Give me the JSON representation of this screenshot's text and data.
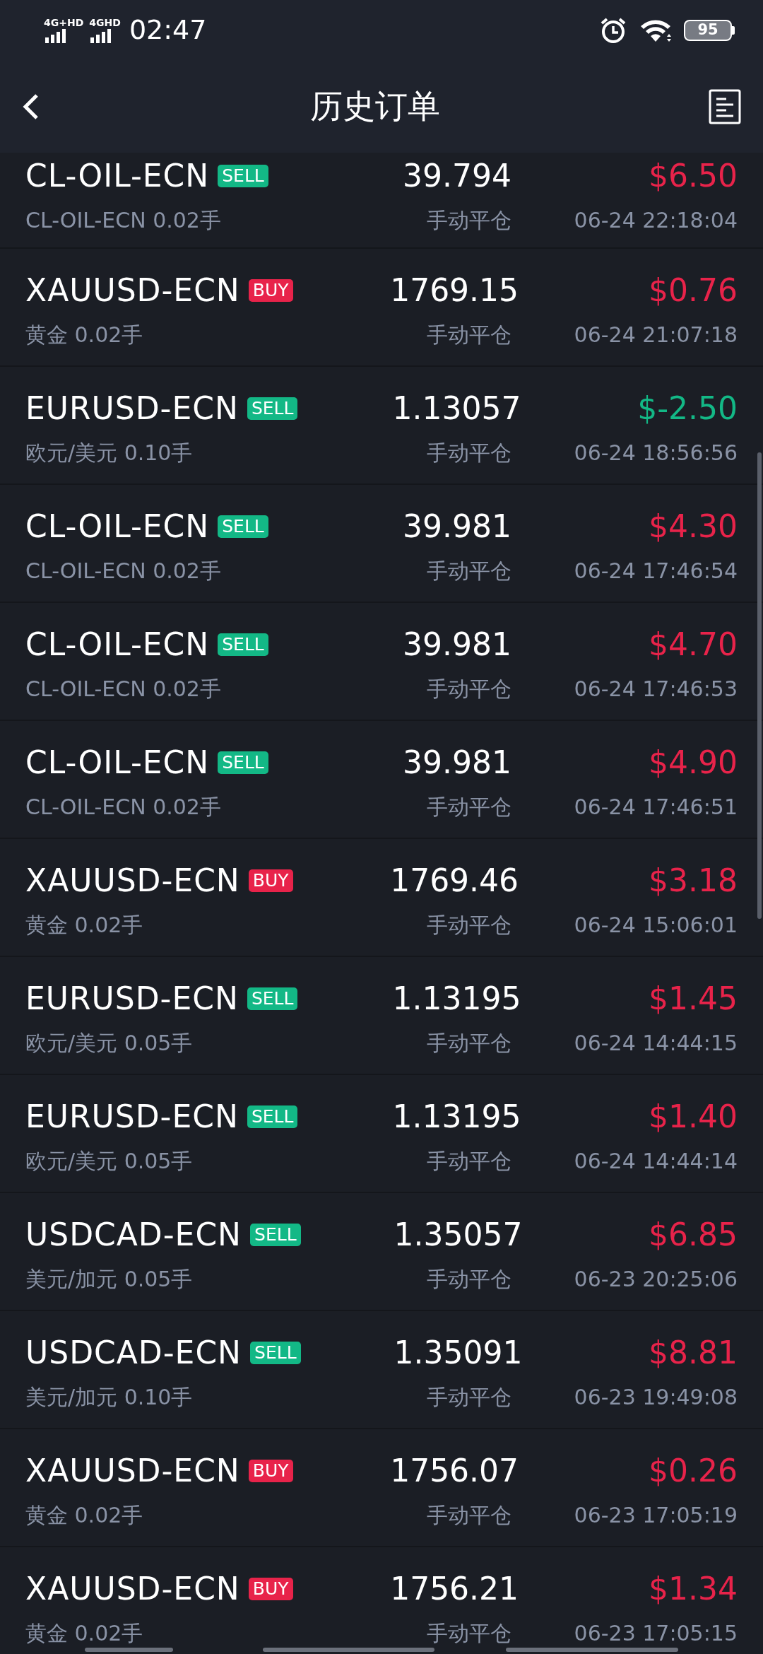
{
  "status_bar": {
    "networks": [
      "4G+HD",
      "4GHD"
    ],
    "time": "02:47",
    "battery": "95"
  },
  "header": {
    "title": "历史订单"
  },
  "orders": [
    {
      "symbol": "CL-OIL-ECN",
      "side": {
        "label": "SELL",
        "kind": "sell"
      },
      "price": "39.794",
      "pnl": {
        "text": "$6.50",
        "color": "#e8234a"
      },
      "detail": "CL-OIL-ECN 0.02手",
      "close_type": "手动平仓",
      "time": "06-24 22:18:04"
    },
    {
      "symbol": "XAUUSD-ECN",
      "side": {
        "label": "BUY",
        "kind": "buy"
      },
      "price": "1769.15",
      "pnl": {
        "text": "$0.76",
        "color": "#e8234a"
      },
      "detail": "黄金 0.02手",
      "close_type": "手动平仓",
      "time": "06-24 21:07:18"
    },
    {
      "symbol": "EURUSD-ECN",
      "side": {
        "label": "SELL",
        "kind": "sell"
      },
      "price": "1.13057",
      "pnl": {
        "text": "$-2.50",
        "color": "#13b886"
      },
      "detail": "欧元/美元 0.10手",
      "close_type": "手动平仓",
      "time": "06-24 18:56:56"
    },
    {
      "symbol": "CL-OIL-ECN",
      "side": {
        "label": "SELL",
        "kind": "sell"
      },
      "price": "39.981",
      "pnl": {
        "text": "$4.30",
        "color": "#e8234a"
      },
      "detail": "CL-OIL-ECN 0.02手",
      "close_type": "手动平仓",
      "time": "06-24 17:46:54"
    },
    {
      "symbol": "CL-OIL-ECN",
      "side": {
        "label": "SELL",
        "kind": "sell"
      },
      "price": "39.981",
      "pnl": {
        "text": "$4.70",
        "color": "#e8234a"
      },
      "detail": "CL-OIL-ECN 0.02手",
      "close_type": "手动平仓",
      "time": "06-24 17:46:53"
    },
    {
      "symbol": "CL-OIL-ECN",
      "side": {
        "label": "SELL",
        "kind": "sell"
      },
      "price": "39.981",
      "pnl": {
        "text": "$4.90",
        "color": "#e8234a"
      },
      "detail": "CL-OIL-ECN 0.02手",
      "close_type": "手动平仓",
      "time": "06-24 17:46:51"
    },
    {
      "symbol": "XAUUSD-ECN",
      "side": {
        "label": "BUY",
        "kind": "buy"
      },
      "price": "1769.46",
      "pnl": {
        "text": "$3.18",
        "color": "#e8234a"
      },
      "detail": "黄金 0.02手",
      "close_type": "手动平仓",
      "time": "06-24 15:06:01"
    },
    {
      "symbol": "EURUSD-ECN",
      "side": {
        "label": "SELL",
        "kind": "sell"
      },
      "price": "1.13195",
      "pnl": {
        "text": "$1.45",
        "color": "#e8234a"
      },
      "detail": "欧元/美元 0.05手",
      "close_type": "手动平仓",
      "time": "06-24 14:44:15"
    },
    {
      "symbol": "EURUSD-ECN",
      "side": {
        "label": "SELL",
        "kind": "sell"
      },
      "price": "1.13195",
      "pnl": {
        "text": "$1.40",
        "color": "#e8234a"
      },
      "detail": "欧元/美元 0.05手",
      "close_type": "手动平仓",
      "time": "06-24 14:44:14"
    },
    {
      "symbol": "USDCAD-ECN",
      "side": {
        "label": "SELL",
        "kind": "sell"
      },
      "price": "1.35057",
      "pnl": {
        "text": "$6.85",
        "color": "#e8234a"
      },
      "detail": "美元/加元 0.05手",
      "close_type": "手动平仓",
      "time": "06-23 20:25:06"
    },
    {
      "symbol": "USDCAD-ECN",
      "side": {
        "label": "SELL",
        "kind": "sell"
      },
      "price": "1.35091",
      "pnl": {
        "text": "$8.81",
        "color": "#e8234a"
      },
      "detail": "美元/加元 0.10手",
      "close_type": "手动平仓",
      "time": "06-23 19:49:08"
    },
    {
      "symbol": "XAUUSD-ECN",
      "side": {
        "label": "BUY",
        "kind": "buy"
      },
      "price": "1756.07",
      "pnl": {
        "text": "$0.26",
        "color": "#e8234a"
      },
      "detail": "黄金 0.02手",
      "close_type": "手动平仓",
      "time": "06-23 17:05:19"
    },
    {
      "symbol": "XAUUSD-ECN",
      "side": {
        "label": "BUY",
        "kind": "buy"
      },
      "price": "1756.21",
      "pnl": {
        "text": "$1.34",
        "color": "#e8234a"
      },
      "detail": "黄金 0.02手",
      "close_type": "手动平仓",
      "time": "06-23 17:05:15"
    }
  ]
}
